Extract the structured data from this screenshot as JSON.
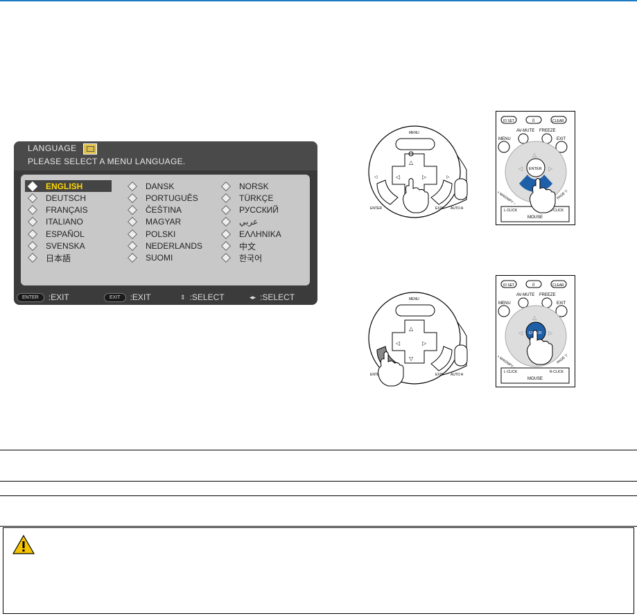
{
  "osd": {
    "title": "LANGUAGE",
    "prompt": "PLEASE SELECT A MENU LANGUAGE.",
    "languages": [
      [
        "ENGLISH",
        "DANSK",
        "NORSK"
      ],
      [
        "DEUTSCH",
        "PORTUGUÊS",
        "TÜRKÇE"
      ],
      [
        "FRANÇAIS",
        "ČEŠTINA",
        "РУССКИЙ"
      ],
      [
        "ITALIANO",
        "MAGYAR",
        "عربي"
      ],
      [
        "ESPAÑOL",
        "POLSKI",
        "ΕΛΛΗΝΙΚΑ"
      ],
      [
        "SVENSKA",
        "NEDERLANDS",
        "中文"
      ],
      [
        "日本語",
        "SUOMI",
        "한국어"
      ]
    ],
    "selected": "ENGLISH",
    "footer": [
      {
        "key": "ENTER",
        "label": ":EXIT"
      },
      {
        "key": "EXIT",
        "label": ":EXIT"
      },
      {
        "key": "⇕",
        "label": ":SELECT"
      },
      {
        "key": "◂▸",
        "label": ":SELECT"
      }
    ]
  },
  "panel": {
    "menu": "MENU",
    "enter": "ENTER",
    "exit": "EXIT",
    "auto": "AUTO A"
  },
  "remote": {
    "id_set": "ID SET",
    "zero": "0",
    "clear": "CLEAR",
    "av_mute": "AV-MUTE",
    "freeze": "FREEZE",
    "menu": "MENU",
    "exit": "EXIT",
    "enter": "ENTER",
    "magnify": "+ MAGNIFY −",
    "page": "PAGE ▽",
    "l_click": "L-CLICK",
    "r_click": "R-CLICK",
    "mouse": "MOUSE"
  },
  "colors": {
    "accent_line": "#1a7ac4",
    "remote_blue": "#1f5fa8",
    "osd_selected_text": "#ffd800"
  },
  "caution": {
    "icon": "warning-triangle-icon"
  }
}
